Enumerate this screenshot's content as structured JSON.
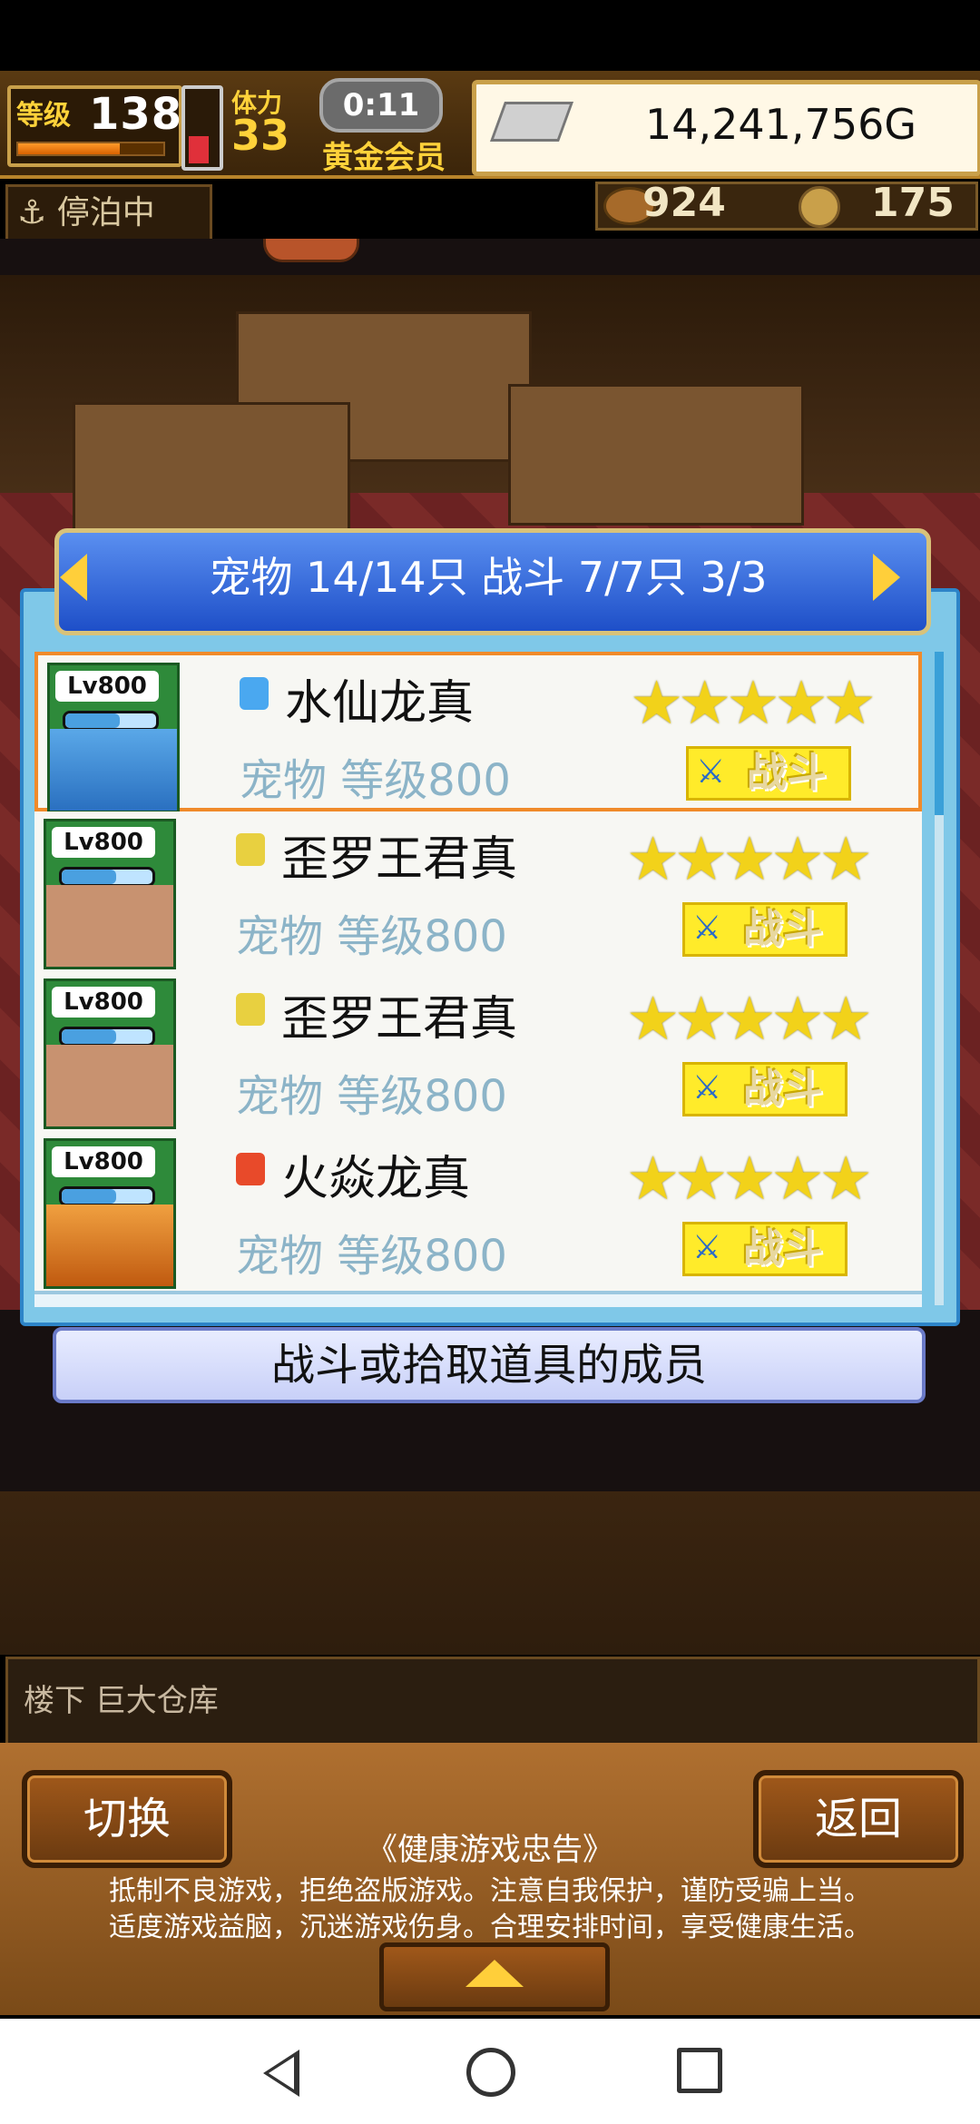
{
  "hud": {
    "level_label": "等级",
    "level": "138",
    "stamina_label": "体力",
    "stamina": "33",
    "timer": "0:11",
    "membership": "黄金会员",
    "gold": "14,241,756G",
    "status": "停泊中",
    "resource_meat": "924",
    "resource_coin": "175"
  },
  "panel": {
    "header": "宠物 14/14只 战斗 7/7只  3/3",
    "footer_caption": "战斗或拾取道具的成员",
    "rows": [
      {
        "level": "Lv800",
        "name": "水仙龙真",
        "subtitle": "宠物 等级800",
        "stars": "★★★★★",
        "action": "战斗",
        "element": "water",
        "selected": true
      },
      {
        "level": "Lv800",
        "name": "歪罗王君真",
        "subtitle": "宠物 等级800",
        "stars": "★★★★★",
        "action": "战斗",
        "element": "thunder"
      },
      {
        "level": "Lv800",
        "name": "歪罗王君真",
        "subtitle": "宠物 等级800",
        "stars": "★★★★★",
        "action": "战斗",
        "element": "thunder"
      },
      {
        "level": "Lv800",
        "name": "火焱龙真",
        "subtitle": "宠物 等级800",
        "stars": "★★★★★",
        "action": "战斗",
        "element": "fire"
      }
    ]
  },
  "location": "楼下 巨大仓库",
  "bottom": {
    "switch_label": "切换",
    "back_label": "返回",
    "notice_title": "《健康游戏忠告》",
    "notice_line1": "抵制不良游戏，拒绝盗版游戏。注意自我保护，谨防受骗上当。",
    "notice_line2": "适度游戏益脑，沉迷游戏伤身。合理安排时间，享受健康生活。"
  },
  "colors": {
    "panel_blue": "#2d84c8",
    "header_blue": "#1e4fc8",
    "fight_yellow": "#ffeb2a",
    "selected_orange": "#f08a2a",
    "star_yellow": "#f2d21a"
  }
}
